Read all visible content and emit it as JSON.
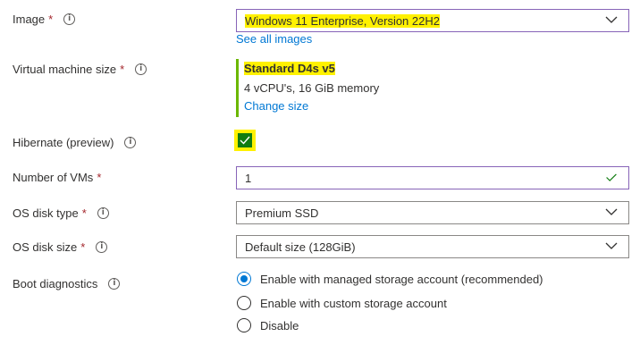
{
  "image": {
    "label": "Image",
    "required": "*",
    "value": "Windows 11 Enterprise, Version 22H2",
    "link": "See all images"
  },
  "vm_size": {
    "label": "Virtual machine size",
    "required": "*",
    "name": "Standard D4s v5",
    "spec": "4 vCPU's, 16 GiB memory",
    "link": "Change size"
  },
  "hibernate": {
    "label": "Hibernate (preview)",
    "checked": true
  },
  "num_vms": {
    "label": "Number of VMs",
    "required": "*",
    "value": "1"
  },
  "os_disk_type": {
    "label": "OS disk type",
    "required": "*",
    "value": "Premium SSD"
  },
  "os_disk_size": {
    "label": "OS disk size",
    "required": "*",
    "value": "Default size (128GiB)"
  },
  "boot_diagnostics": {
    "label": "Boot diagnostics",
    "options": [
      "Enable with managed storage account (recommended)",
      "Enable with custom storage account",
      "Disable"
    ],
    "selected_index": 0
  },
  "colors": {
    "highlight": "#fff100",
    "accent": "#0078d4",
    "required": "#a4262c",
    "checkbox": "#107c10",
    "valid": "#107c10",
    "focus_border": "#8764b8"
  },
  "icons": [
    "info-icon",
    "chevron-down-icon",
    "checkmark-icon",
    "valid-check-icon"
  ]
}
